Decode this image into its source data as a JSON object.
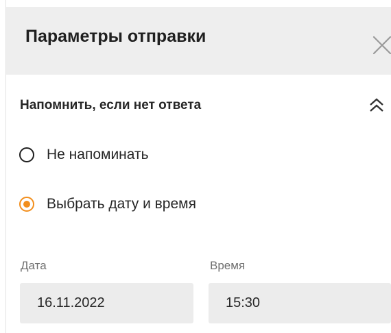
{
  "header": {
    "title": "Параметры отправки",
    "close_icon": "close-icon"
  },
  "section": {
    "title": "Напомнить, если нет ответа",
    "collapse_icon": "double-chevron-up-icon"
  },
  "reminder_options": [
    {
      "label": "Не напоминать",
      "selected": false
    },
    {
      "label": "Выбрать дату и время",
      "selected": true
    }
  ],
  "date_field": {
    "label": "Дата",
    "value": "16.11.2022"
  },
  "time_field": {
    "label": "Время",
    "value": "15:30"
  },
  "colors": {
    "accent": "#f28e1c",
    "header_bg": "#eeeeee",
    "field_bg": "#ececec"
  }
}
